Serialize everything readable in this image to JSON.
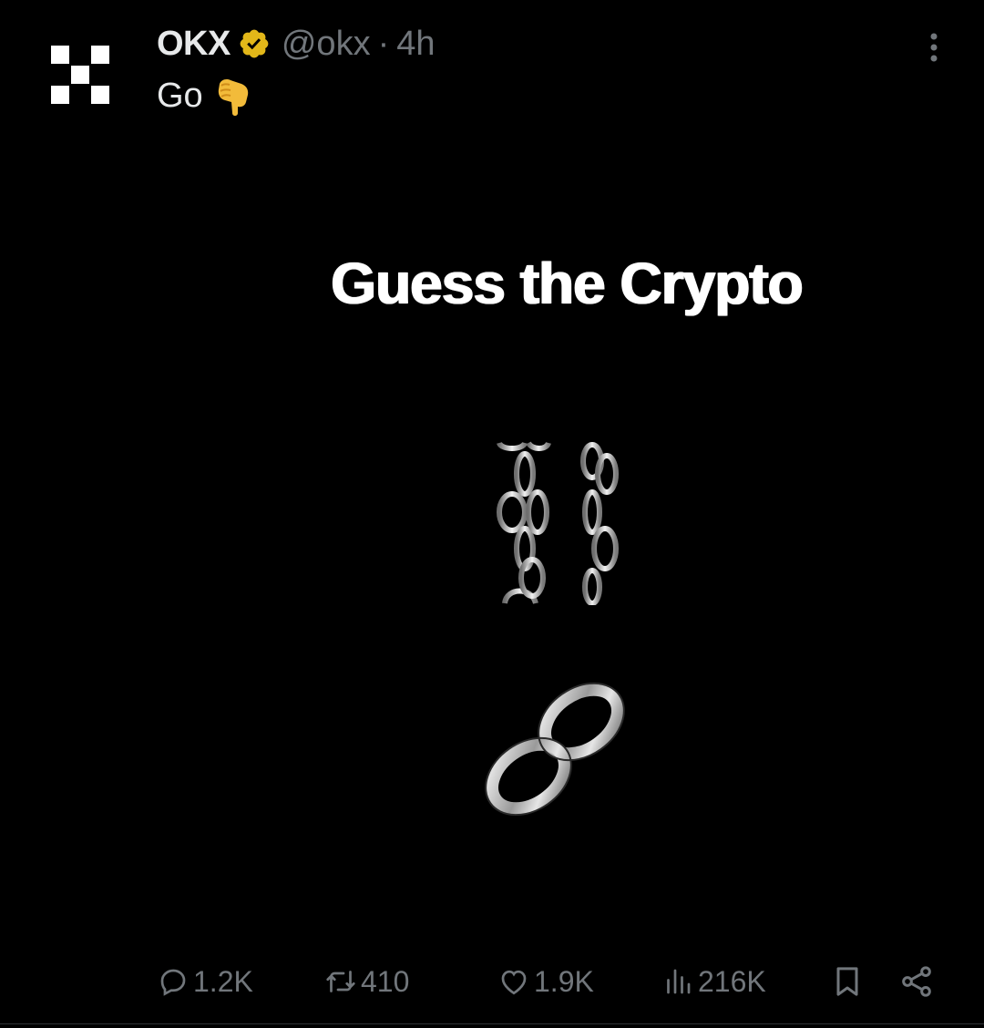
{
  "post": {
    "author_name": "OKX",
    "handle": "@okx",
    "separator": "·",
    "time": "4h",
    "text": "Go",
    "avatar_icon": "okx-logo-icon",
    "verified_icon": "verified-gold-badge-icon",
    "verified_color": "#e2b719",
    "emoji_icon": "backhand-index-pointing-down-icon",
    "more_icon": "more-vertical-icon"
  },
  "media": {
    "title": "Guess the Crypto",
    "emoji_1": "chains-icon",
    "emoji_2": "link-icon"
  },
  "actions": {
    "replies": "1.2K",
    "reposts": "410",
    "likes": "1.9K",
    "views": "216K",
    "reply_icon": "reply-bubble-icon",
    "repost_icon": "repost-icon",
    "like_icon": "heart-icon",
    "views_icon": "views-bar-chart-icon",
    "bookmark_icon": "bookmark-icon",
    "share_icon": "share-icon"
  },
  "colors": {
    "background": "#000000",
    "primary_text": "#e7e9ea",
    "secondary_text": "#71767b"
  }
}
